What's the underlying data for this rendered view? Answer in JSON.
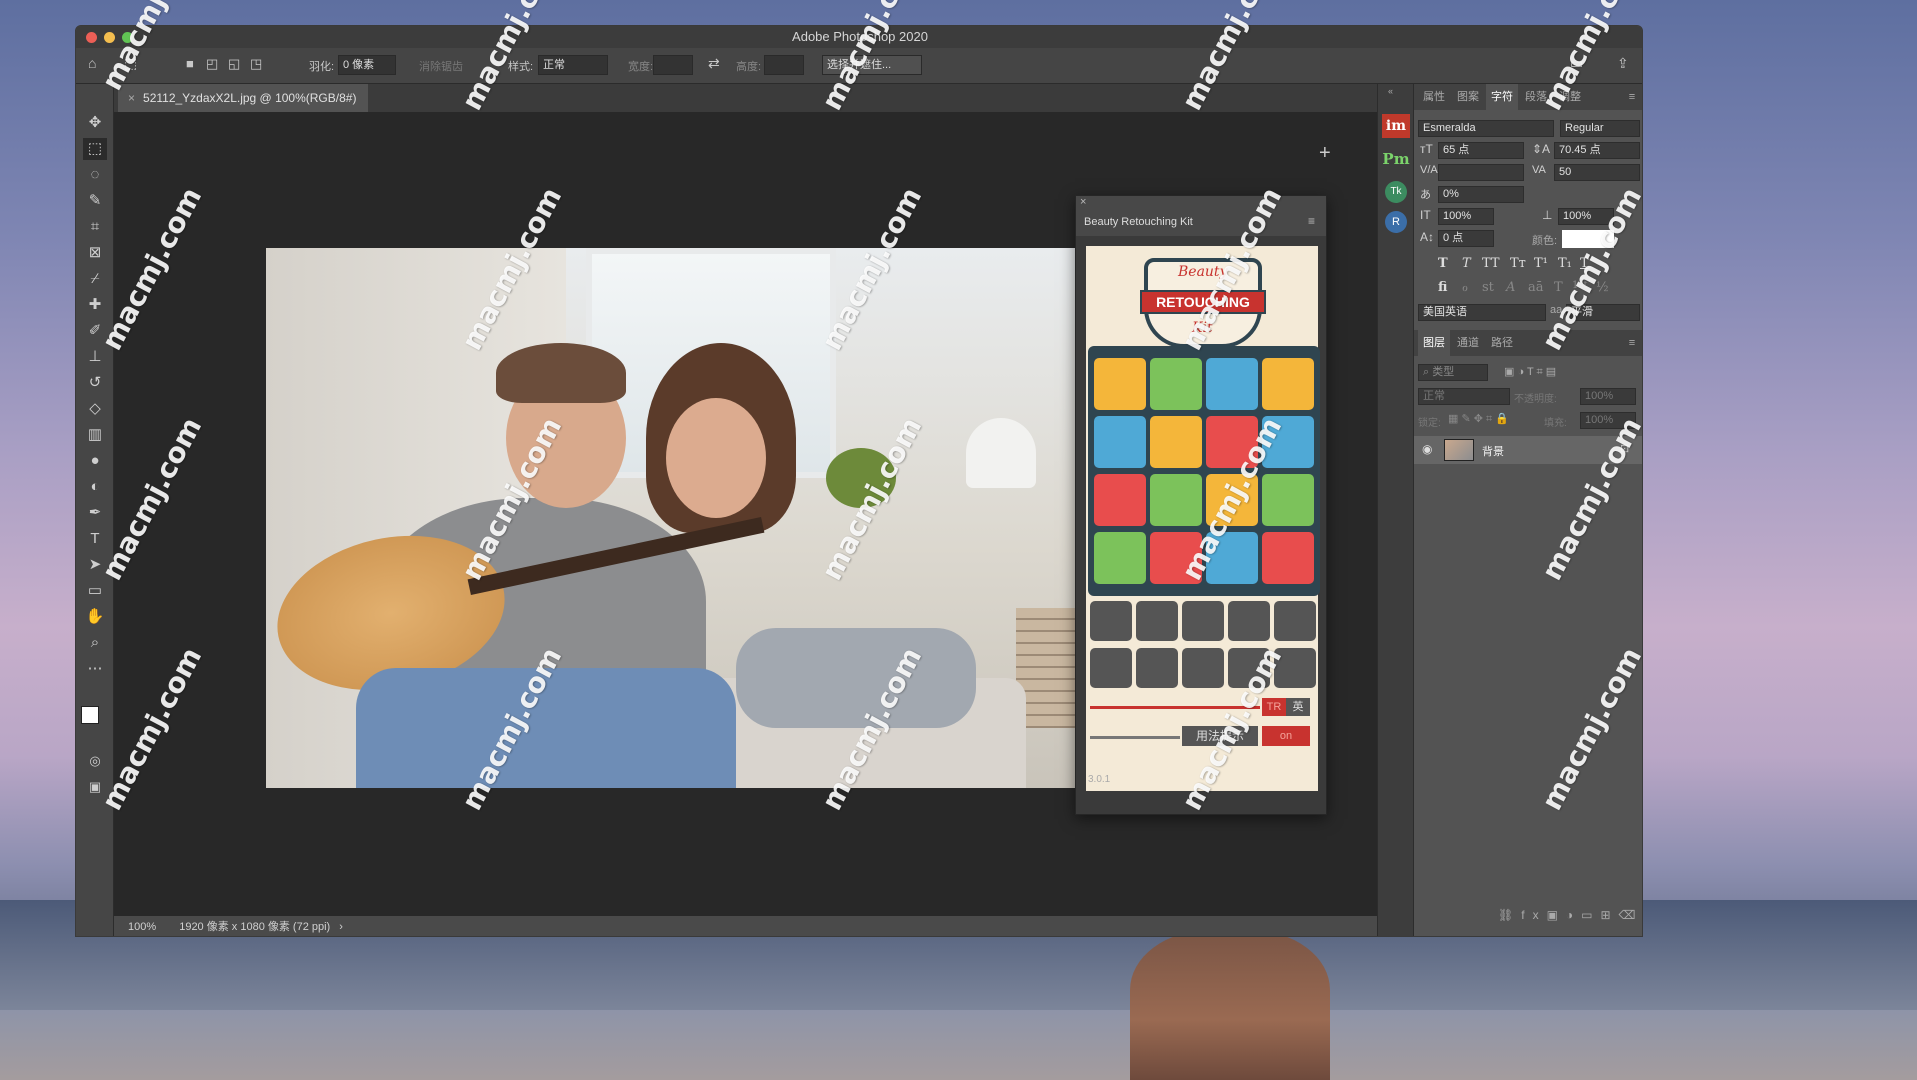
{
  "window": {
    "title": "Adobe Photoshop 2020"
  },
  "options": {
    "feather_label": "羽化:",
    "feather_value": "0 像素",
    "antialias_label": "消除锯齿",
    "style_label": "样式:",
    "style_value": "正常",
    "width_label": "宽度:",
    "height_label": "高度:",
    "select_mask": "选择并遮住..."
  },
  "document": {
    "tab_title": "52112_YzdaxX2L.jpg @ 100%(RGB/8#)"
  },
  "status": {
    "zoom": "100%",
    "info": "1920 像素 x 1080 像素 (72 ppi)",
    "arrow": "›"
  },
  "tools": [
    "move-icon",
    "marquee-icon",
    "lasso-icon",
    "quick-select-icon",
    "crop-icon",
    "frame-icon",
    "eyedropper-icon",
    "healing-brush-icon",
    "brush-icon",
    "stamp-icon",
    "history-brush-icon",
    "eraser-icon",
    "gradient-icon",
    "blur-icon",
    "dodge-icon",
    "pen-icon",
    "type-icon",
    "path-select-icon",
    "rectangle-icon",
    "hand-icon",
    "zoom-icon",
    "more-icon"
  ],
  "char_panel": {
    "tabs": [
      "属性",
      "图案",
      "字符",
      "段落",
      "调整"
    ],
    "active_tab": "字符",
    "font": "Esmeralda",
    "style": "Regular",
    "size": "65 点",
    "leading": "70.45 点",
    "kerning": "",
    "tracking": "50",
    "scale_pct": "0%",
    "vscale": "100%",
    "hscale": "100%",
    "baseline": "0 点",
    "color_label": "颜色:",
    "language": "美国英语",
    "aa_label": "aa",
    "antialias": "平滑",
    "text_styles": [
      "T",
      "T",
      "TT",
      "Tт",
      "T¹",
      "T₁",
      "T"
    ],
    "opentype": [
      "fi",
      "ℴ",
      "st",
      "A",
      "aā",
      "T",
      "1st",
      "½"
    ]
  },
  "layers_panel": {
    "tabs": [
      "图层",
      "通道",
      "路径"
    ],
    "filter_placeholder": "类型",
    "blend": "正常",
    "opacity_label": "不透明度:",
    "opacity": "100%",
    "lock_label": "锁定:",
    "fill_label": "填充:",
    "fill": "100%",
    "layer_name": "背景"
  },
  "plugin": {
    "title": "Beauty Retouching Kit",
    "logo_top": "Beauty",
    "logo_main": "RETOUCHING",
    "logo_bottom": "Kit",
    "lang_tr": "TR",
    "lang_en": "英",
    "hint": "用法提示",
    "toggle": "on",
    "version": "3.0.1"
  },
  "side_icons": [
    "im",
    "Pm",
    "Tk",
    "R"
  ],
  "watermark": "macmj.com",
  "colors": {
    "accent": "#c8332f",
    "kit_bg": "#f4ead7",
    "kit_grid": "#2f4550"
  }
}
